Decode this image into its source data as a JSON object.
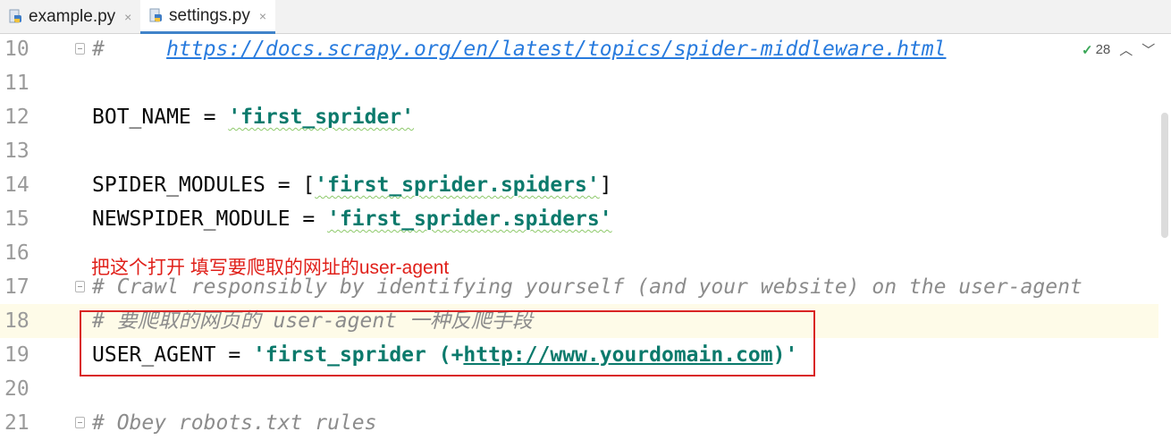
{
  "tabs": [
    {
      "label": "example.py",
      "close": "×",
      "active": false
    },
    {
      "label": "settings.py",
      "close": "×",
      "active": true
    }
  ],
  "inspections": {
    "count": "28",
    "up": "^",
    "down": "v"
  },
  "lines": [
    {
      "num": "10",
      "comment_prefix": "#     ",
      "url": "https://docs.scrapy.org/en/latest/topics/spider-middleware.html"
    },
    {
      "num": "11"
    },
    {
      "num": "12",
      "name": "BOT_NAME = ",
      "value": "'first_sprider'"
    },
    {
      "num": "13"
    },
    {
      "num": "14",
      "name": "SPIDER_MODULES = [",
      "value": "'first_sprider.spiders'",
      "suffix": "]"
    },
    {
      "num": "15",
      "name": "NEWSPIDER_MODULE = ",
      "value": "'first_sprider.spiders'"
    },
    {
      "num": "16"
    },
    {
      "num": "17",
      "comment": "# Crawl responsibly by identifying yourself (and your website) on the user-agent"
    },
    {
      "num": "18",
      "comment": "# 要爬取的网页的 user-agent 一种反爬手段"
    },
    {
      "num": "19",
      "name": "USER_AGENT = ",
      "value_pre": "'first_sprider (+",
      "value_link": "http://www.yourdomain.com",
      "value_post": ")'"
    },
    {
      "num": "20"
    },
    {
      "num": "21",
      "comment": "# Obey robots.txt rules"
    }
  ],
  "annotation": "把这个打开 填写要爬取的网址的user-agent",
  "colors": {
    "annotation": "#e0201a",
    "highlight_box": "#d92424",
    "current_line": "#fefbe8",
    "string": "#0b7a6c",
    "comment": "#8c8c8c",
    "link": "#287bde"
  }
}
